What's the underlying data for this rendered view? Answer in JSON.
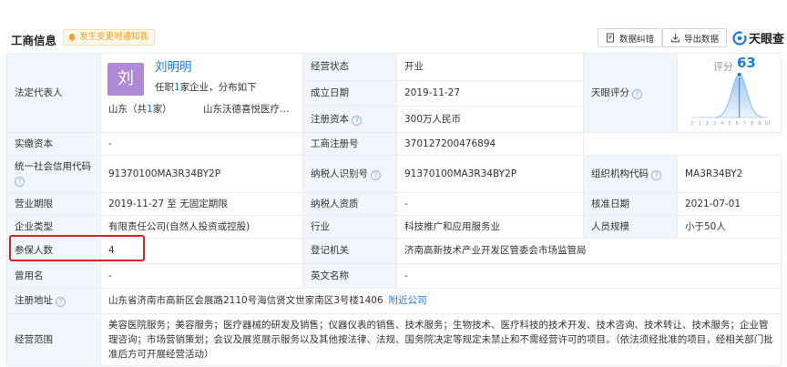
{
  "header": {
    "title": "工商信息",
    "notify_label": "发生变更时通知我",
    "error_button": "数据纠错",
    "export_button": "导出数据",
    "brand_name": "天眼查"
  },
  "colors": {
    "accent": "#1a7ae6",
    "label_bg": "#f1f6fd",
    "avatar": "#b08ad6",
    "warn": "#f0a020",
    "highlight": "#e02020"
  },
  "legal_rep": {
    "label": "法定代表人",
    "avatar_char": "刘",
    "name": "刘明明",
    "sub_prefix": "任职",
    "sub_count": "1",
    "sub_suffix": "家企业，分布如下",
    "region_prefix": "山东（共",
    "region_count": "1",
    "region_suffix": "家）",
    "company": "山东沃德喜悦医疗美容有限公司"
  },
  "rows": {
    "status_label": "经营状态",
    "status_value": "开业",
    "founded_label": "成立日期",
    "founded_value": "2019-11-27",
    "capital_label": "注册资本",
    "capital_value": "300万人民币",
    "paid_label": "实缴资本",
    "paid_value": "-",
    "score_label": "天眼评分",
    "score_caption": "评分",
    "score_value": "63",
    "regno_label": "工商注册号",
    "regno_value": "370127200476894",
    "credit_label": "统一社会信用代码",
    "credit_value": "91370100MA3R34BY2P",
    "taxid_label": "纳税人识别号",
    "taxid_value": "91370100MA3R34BY2P",
    "org_label": "组织机构代码",
    "org_value": "MA3R34BY2",
    "term_label": "营业期限",
    "term_value": "2019-11-27 至 无固定期限",
    "taxq_label": "纳税人资质",
    "taxq_value": "-",
    "approve_label": "核准日期",
    "approve_value": "2021-07-01",
    "type_label": "企业类型",
    "type_value": "有限责任公司(自然人投资或控股)",
    "industry_label": "行业",
    "industry_value": "科技推广和应用服务业",
    "staff_label": "人员规模",
    "staff_value": "小于50人",
    "insured_label": "参保人数",
    "insured_value": "4",
    "authority_label": "登记机关",
    "authority_value": "济南高新技术产业开发区管委会市场监管局",
    "formername_label": "曾用名",
    "formername_value": "-",
    "en_label": "英文名称",
    "en_value": "-",
    "address_label": "注册地址",
    "address_value": "山东省济南市高新区会展路2110号海信贤文世家南区3号楼1406",
    "address_link": "附近公司",
    "scope_label": "经营范围",
    "scope_value": "美容医院服务；美容服务；医疗器械的研发及销售；仪器仪表的销售、技术服务；生物技术、医疗科技的技术开发、技术咨询、技术转让、技术服务；企业管理咨询；市场营销策划；会议及展览展示服务以及其他按法律、法规、国务院决定等规定未禁止和不需经营许可的项目。（依法须经批准的项目，经相关部门批准后方可开展经营活动）"
  },
  "chart_data": {
    "type": "area",
    "x": [
      0,
      1,
      2,
      3,
      4,
      5,
      6,
      7,
      8,
      9,
      10
    ],
    "tick_labels": [
      "0",
      "1",
      "2",
      "3",
      "4",
      "5",
      "6",
      "7",
      "8",
      "9",
      "10"
    ],
    "marker_x": 6.3,
    "marker_value": "63",
    "xlim": [
      0,
      10
    ],
    "grid": false
  }
}
